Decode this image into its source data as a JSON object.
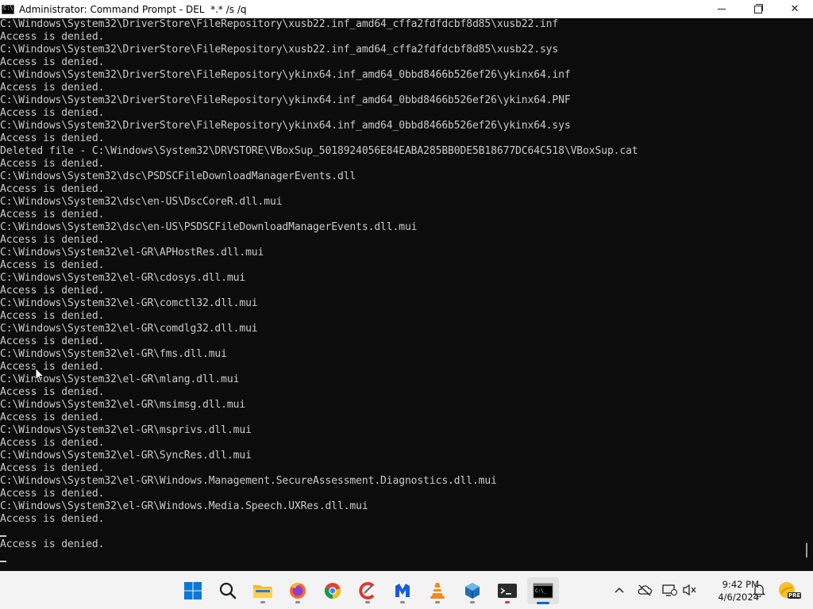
{
  "window": {
    "title": "Administrator: Command Prompt - DEL  *.* /s /q",
    "minimize_label": "—",
    "close_label": "✕"
  },
  "console": {
    "lines": [
      "C:\\Windows\\System32\\DriverStore\\FileRepository\\xusb22.inf_amd64_cffa2fdfdcbf8d85\\xusb22.inf",
      "Access is denied.",
      "C:\\Windows\\System32\\DriverStore\\FileRepository\\xusb22.inf_amd64_cffa2fdfdcbf8d85\\xusb22.sys",
      "Access is denied.",
      "C:\\Windows\\System32\\DriverStore\\FileRepository\\ykinx64.inf_amd64_0bbd8466b526ef26\\ykinx64.inf",
      "Access is denied.",
      "C:\\Windows\\System32\\DriverStore\\FileRepository\\ykinx64.inf_amd64_0bbd8466b526ef26\\ykinx64.PNF",
      "Access is denied.",
      "C:\\Windows\\System32\\DriverStore\\FileRepository\\ykinx64.inf_amd64_0bbd8466b526ef26\\ykinx64.sys",
      "Access is denied.",
      "Deleted file - C:\\Windows\\System32\\DRVSTORE\\VBoxSup_5018924056E84EABA285BB0DE5B18677DC64C518\\VBoxSup.cat",
      "Access is denied.",
      "C:\\Windows\\System32\\dsc\\PSDSCFileDownloadManagerEvents.dll",
      "Access is denied.",
      "C:\\Windows\\System32\\dsc\\en-US\\DscCoreR.dll.mui",
      "Access is denied.",
      "C:\\Windows\\System32\\dsc\\en-US\\PSDSCFileDownloadManagerEvents.dll.mui",
      "Access is denied.",
      "C:\\Windows\\System32\\el-GR\\APHostRes.dll.mui",
      "Access is denied.",
      "C:\\Windows\\System32\\el-GR\\cdosys.dll.mui",
      "Access is denied.",
      "C:\\Windows\\System32\\el-GR\\comctl32.dll.mui",
      "Access is denied.",
      "C:\\Windows\\System32\\el-GR\\comdlg32.dll.mui",
      "Access is denied.",
      "C:\\Windows\\System32\\el-GR\\fms.dll.mui",
      "Access is denied.",
      "C:\\Windows\\System32\\el-GR\\mlang.dll.mui",
      "Access is denied.",
      "C:\\Windows\\System32\\el-GR\\msimsg.dll.mui",
      "Access is denied.",
      "C:\\Windows\\System32\\el-GR\\msprivs.dll.mui",
      "Access is denied.",
      "C:\\Windows\\System32\\el-GR\\SyncRes.dll.mui",
      "Access is denied.",
      "C:\\Windows\\System32\\el-GR\\Windows.Management.SecureAssessment.Diagnostics.dll.mui",
      "Access is denied.",
      "C:\\Windows\\System32\\el-GR\\Windows.Media.Speech.UXRes.dll.mui",
      "Access is denied.",
      "",
      "Access is denied."
    ]
  },
  "taskbar": {
    "apps": [
      {
        "name": "start-button",
        "icon": "windows-logo-icon"
      },
      {
        "name": "search-button",
        "icon": "search-icon"
      },
      {
        "name": "file-explorer",
        "icon": "folder-icon"
      },
      {
        "name": "firefox",
        "icon": "firefox-icon"
      },
      {
        "name": "chrome",
        "icon": "chrome-icon"
      },
      {
        "name": "ccleaner",
        "icon": "ccleaner-icon"
      },
      {
        "name": "malwarebytes",
        "icon": "malwarebytes-icon"
      },
      {
        "name": "vlc",
        "icon": "vlc-icon"
      },
      {
        "name": "virtualbox",
        "icon": "virtualbox-icon"
      },
      {
        "name": "terminal",
        "icon": "terminal-icon"
      },
      {
        "name": "command-prompt",
        "icon": "cmd-icon"
      }
    ],
    "tray": {
      "time": "9:42 PM",
      "date": "4/6/2024",
      "badge": "PRE"
    }
  },
  "colors": {
    "console_bg": "#0c0c0c",
    "console_text": "#cccccc",
    "taskbar_bg": "#f3f3f3",
    "accent": "#0067c0"
  }
}
